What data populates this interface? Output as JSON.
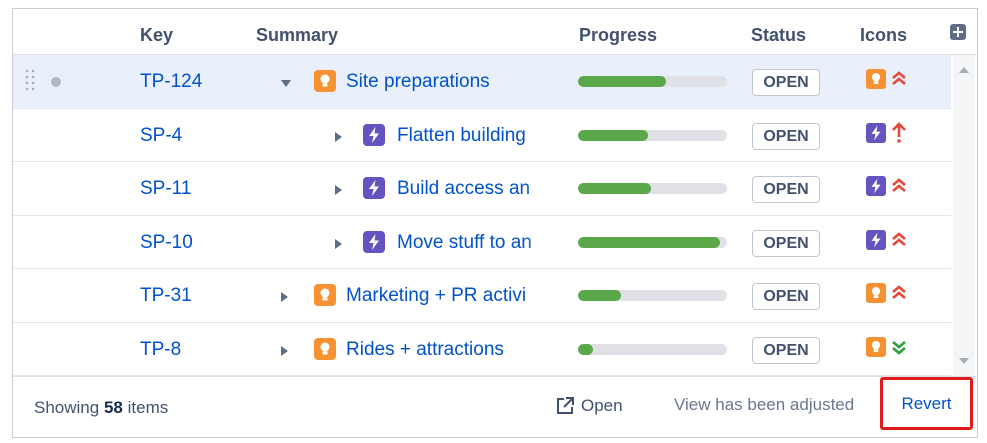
{
  "columns": {
    "key": "Key",
    "summary": "Summary",
    "progress": "Progress",
    "status": "Status",
    "icons": "Icons"
  },
  "rows": [
    {
      "key": "TP-124",
      "summary": "Site preparations",
      "type": "story-icon",
      "toggle": "expanded",
      "indent": 0,
      "progress": 0.59,
      "status": "OPEN",
      "priority": "highest"
    },
    {
      "key": "SP-4",
      "summary": "Flatten building",
      "type": "epic-icon",
      "toggle": "collapsed",
      "indent": 1,
      "progress": 0.47,
      "status": "OPEN",
      "priority": "blocker"
    },
    {
      "key": "SP-11",
      "summary": "Build access an",
      "type": "epic-icon",
      "toggle": "collapsed",
      "indent": 1,
      "progress": 0.49,
      "status": "OPEN",
      "priority": "highest"
    },
    {
      "key": "SP-10",
      "summary": "Move stuff to an",
      "type": "epic-icon",
      "toggle": "collapsed",
      "indent": 1,
      "progress": 0.95,
      "status": "OPEN",
      "priority": "highest"
    },
    {
      "key": "TP-31",
      "summary": "Marketing + PR activi",
      "type": "story-icon",
      "toggle": "collapsed",
      "indent": 0,
      "progress": 0.29,
      "status": "OPEN",
      "priority": "highest"
    },
    {
      "key": "TP-8",
      "summary": "Rides + attractions",
      "type": "story-icon",
      "toggle": "collapsed",
      "indent": 0,
      "progress": 0.1,
      "status": "OPEN",
      "priority": "lowest"
    }
  ],
  "footer": {
    "showing_prefix": "Showing",
    "showing_count": "58",
    "showing_suffix": "items",
    "open_label": "Open",
    "adjusted_text": "View has been adjusted",
    "revert_label": "Revert"
  },
  "colors": {
    "link": "#0052cc",
    "progress_fill": "#5aa84a",
    "story": "#f79232",
    "epic": "#6554c0",
    "priority_high": "#e5493a",
    "priority_low": "#2e9e3e",
    "highlight_box": "#e01b1b"
  }
}
